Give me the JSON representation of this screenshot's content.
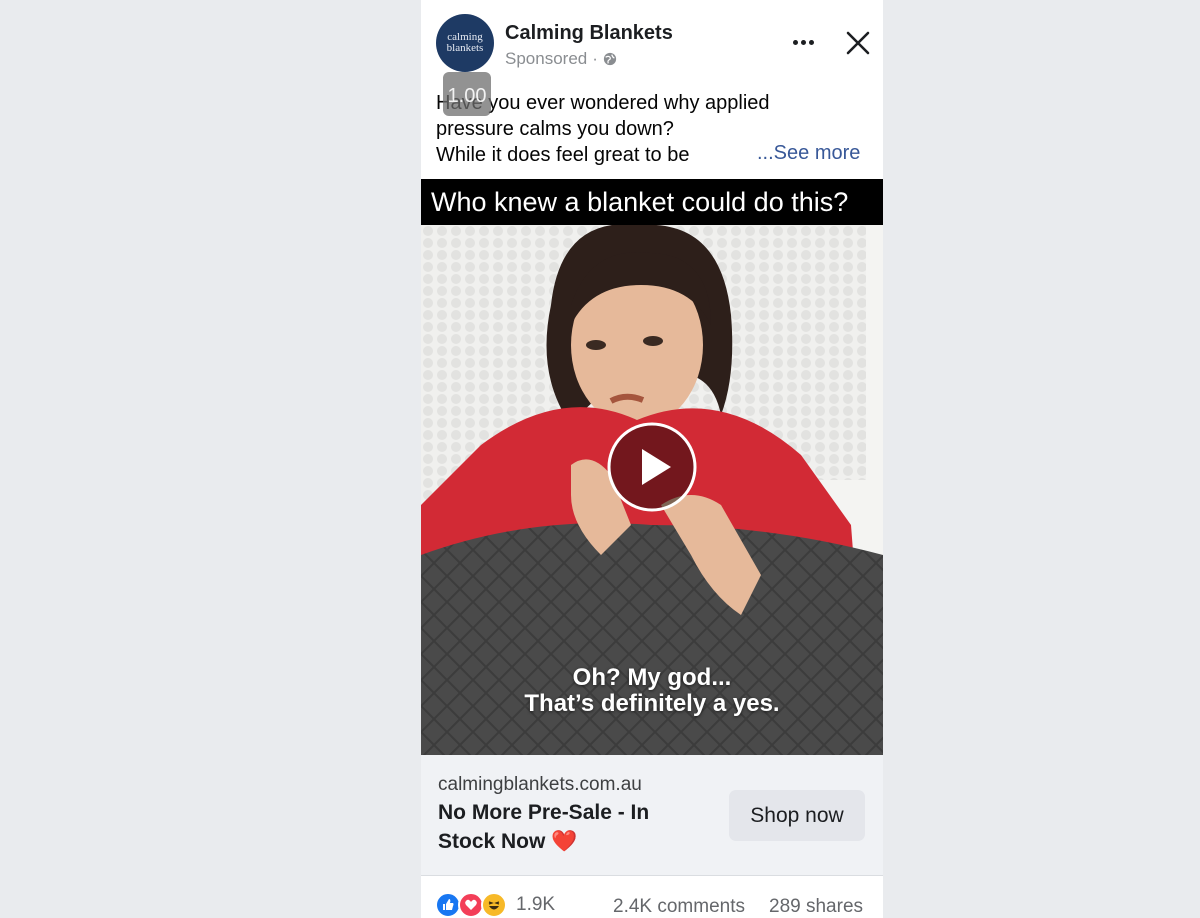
{
  "post": {
    "page_name": "Calming Blankets",
    "avatar_line1": "calming",
    "avatar_line2": "blankets",
    "sponsored": "Sponsored",
    "separator": "·",
    "privacy_icon": "globe-icon",
    "more_icon": "more-options-icon",
    "close_icon": "close-icon"
  },
  "speed_badge": "1.00",
  "caption": {
    "line1": "Have you ever wondered why applied",
    "line2": "pressure calms you down?",
    "line3": "While it does feel great to be",
    "see_more": "...See more"
  },
  "video": {
    "title": "Who knew a blanket could do this?",
    "subtitle_line1": "Oh? My god...",
    "subtitle_line2": "That’s definitely a yes.",
    "play_icon": "play-icon"
  },
  "link": {
    "domain": "calmingblankets.com.au",
    "headline": "No More Pre-Sale - In Stock Now",
    "headline_emoji": "❤️",
    "cta": "Shop now"
  },
  "stats": {
    "reactions": [
      "like",
      "love",
      "haha"
    ],
    "reaction_count": "1.9K",
    "comments": "2.4K comments",
    "shares": "289 shares"
  },
  "colors": {
    "page_background": "#e9ebee",
    "card_background": "#ffffff",
    "link_blue": "#385898",
    "cta_background": "#e4e6eb",
    "avatar_navy": "#1e3a64",
    "shirt_red": "#d22a35"
  }
}
